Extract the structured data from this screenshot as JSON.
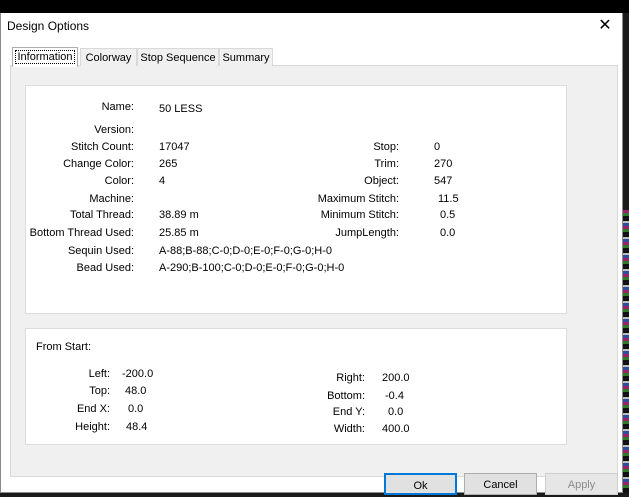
{
  "dialog": {
    "title": "Design Options",
    "close_glyph": "✕"
  },
  "tabs": [
    "Information",
    "Colorway",
    "Stop Sequence",
    "Summary"
  ],
  "info": {
    "name": {
      "label": "Name:",
      "value": "50 LESS"
    },
    "version": {
      "label": "Version:",
      "value": ""
    },
    "stitch_count": {
      "label": "Stitch Count:",
      "value": "17047"
    },
    "change_color": {
      "label": "Change Color:",
      "value": "265"
    },
    "color": {
      "label": "Color:",
      "value": "4"
    },
    "machine": {
      "label": "Machine:",
      "value": ""
    },
    "total_thread": {
      "label": "Total Thread:",
      "value": "38.89 m"
    },
    "bottom_thread": {
      "label": "Bottom Thread Used:",
      "value": "25.85 m"
    },
    "sequin": {
      "label": "Sequin Used:",
      "value": "A-88;B-88;C-0;D-0;E-0;F-0;G-0;H-0"
    },
    "bead": {
      "label": "Bead Used:",
      "value": "A-290;B-100;C-0;D-0;E-0;F-0;G-0;H-0"
    },
    "stop": {
      "label": "Stop:",
      "value": "0"
    },
    "trim": {
      "label": "Trim:",
      "value": "270"
    },
    "object": {
      "label": "Object:",
      "value": "547"
    },
    "max_stitch": {
      "label": "Maximum Stitch:",
      "value": "11.5"
    },
    "min_stitch": {
      "label": "Minimum Stitch:",
      "value": "0.5"
    },
    "jump_length": {
      "label": "JumpLength:",
      "value": "0.0"
    }
  },
  "from_start": {
    "title": "From Start:",
    "left": {
      "label": "Left:",
      "value": "-200.0"
    },
    "top": {
      "label": "Top:",
      "value": "48.0"
    },
    "end_x": {
      "label": "End X:",
      "value": "0.0"
    },
    "height": {
      "label": "Height:",
      "value": "48.4"
    },
    "right": {
      "label": "Right:",
      "value": "200.0"
    },
    "bottom": {
      "label": "Bottom:",
      "value": "-0.4"
    },
    "end_y": {
      "label": "End Y:",
      "value": "0.0"
    },
    "width": {
      "label": "Width:",
      "value": "400.0"
    }
  },
  "buttons": {
    "ok": "Ok",
    "cancel": "Cancel",
    "apply": "Apply"
  }
}
